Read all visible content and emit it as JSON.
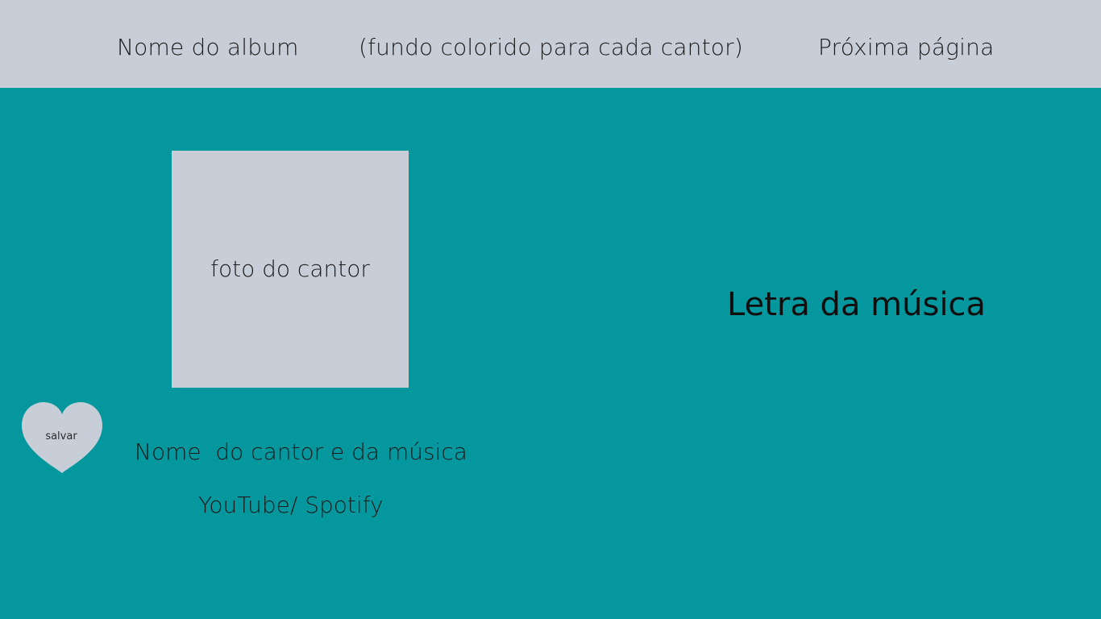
{
  "header": {
    "album_name": "Nome do album",
    "background_note": "(fundo colorido para cada cantor)",
    "next_page": "Próxima página"
  },
  "main": {
    "photo_label": "foto do cantor",
    "lyrics_label": "Letra da música",
    "save_label": "salvar",
    "song_title": "Nome  do cantor e da música",
    "links_label": "YouTube/ Spotify"
  },
  "colors": {
    "background": "#04979d",
    "panel": "#c8ced8"
  },
  "icons": {
    "save": "heart-icon"
  }
}
